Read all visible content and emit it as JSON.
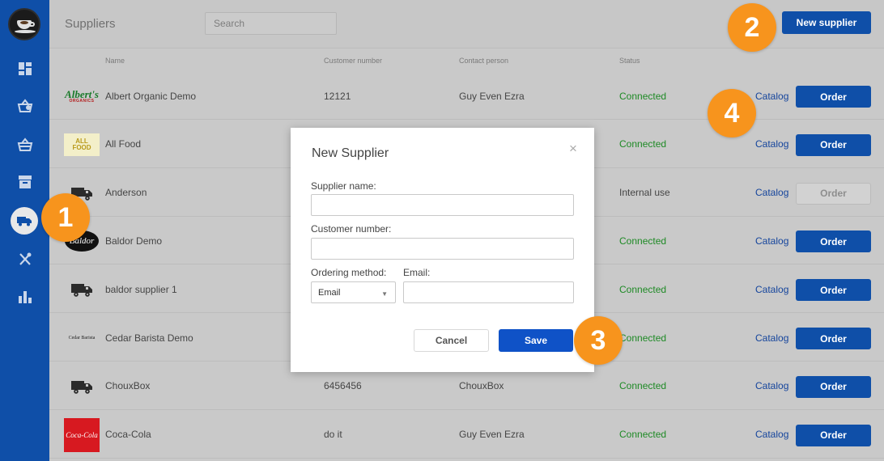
{
  "header": {
    "title": "Suppliers",
    "search_placeholder": "Search",
    "new_supplier_label": "New supplier"
  },
  "sidebar": {
    "items": [
      {
        "icon": "dashboard-icon"
      },
      {
        "icon": "basket-add-icon"
      },
      {
        "icon": "basket-icon"
      },
      {
        "icon": "archive-icon"
      },
      {
        "icon": "truck-icon",
        "active": true
      },
      {
        "icon": "utensils-icon"
      },
      {
        "icon": "bar-chart-icon"
      }
    ]
  },
  "table": {
    "columns": [
      "Name",
      "Customer number",
      "Contact person",
      "Status"
    ],
    "rows": [
      {
        "name": "Albert Organic Demo",
        "customer_number": "12121",
        "contact": "Guy Even Ezra",
        "status": "Connected",
        "catalog": "Catalog",
        "order": "Order",
        "logo": "albert"
      },
      {
        "name": "All Food",
        "customer_number": "",
        "contact": "",
        "status": "Connected",
        "catalog": "Catalog",
        "order": "Order",
        "logo": "allfood"
      },
      {
        "name": "Anderson",
        "customer_number": "",
        "contact": "",
        "status": "Internal use",
        "catalog": "Catalog",
        "order": "Order",
        "logo": "truck"
      },
      {
        "name": "Baldor Demo",
        "customer_number": "",
        "contact": "",
        "status": "Connected",
        "catalog": "Catalog",
        "order": "Order",
        "logo": "baldor"
      },
      {
        "name": "baldor supplier 1",
        "customer_number": "",
        "contact": "",
        "status": "Connected",
        "catalog": "Catalog",
        "order": "Order",
        "logo": "truck"
      },
      {
        "name": "Cedar Barista Demo",
        "customer_number": "",
        "contact": "",
        "status": "Connected",
        "catalog": "Catalog",
        "order": "Order",
        "logo": "cedar"
      },
      {
        "name": "ChouxBox",
        "customer_number": "6456456",
        "contact": "ChouxBox",
        "status": "Connected",
        "catalog": "Catalog",
        "order": "Order",
        "logo": "truck"
      },
      {
        "name": "Coca-Cola",
        "customer_number": "do it",
        "contact": "Guy Even Ezra",
        "status": "Connected",
        "catalog": "Catalog",
        "order": "Order",
        "logo": "cocacola"
      }
    ]
  },
  "logos": {
    "albert": {
      "main": "Albert's",
      "sub": "ORGANICS"
    },
    "allfood": {
      "main": "ALL FOOD"
    },
    "baldor": {
      "main": "Baldor"
    },
    "cedar": {
      "main": "Cedar Barista"
    },
    "cocacola": {
      "main": "Coca-Cola"
    }
  },
  "modal": {
    "title": "New Supplier",
    "close_label": "×",
    "supplier_name_label": "Supplier name:",
    "customer_number_label": "Customer number:",
    "ordering_method_label": "Ordering method:",
    "ordering_method_value": "Email",
    "email_label": "Email:",
    "cancel_label": "Cancel",
    "save_label": "Save"
  },
  "callouts": [
    "1",
    "2",
    "3",
    "4"
  ],
  "colors": {
    "brand_blue": "#0f4fa8",
    "connected_green": "#1e8a25",
    "callout_orange": "#f7941d"
  }
}
